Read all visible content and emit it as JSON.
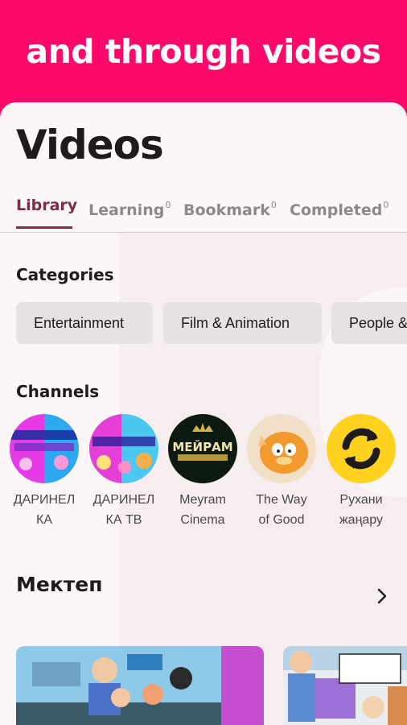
{
  "banner": {
    "text": "and through videos"
  },
  "page": {
    "title": "Videos"
  },
  "tabs": [
    {
      "label": "Library",
      "badge": ""
    },
    {
      "label": "Learning",
      "badge": "0"
    },
    {
      "label": "Bookmark",
      "badge": "0"
    },
    {
      "label": "Completed",
      "badge": "0"
    }
  ],
  "categories": {
    "title": "Categories",
    "items": [
      "Entertainment",
      "Film & Animation",
      "People &"
    ]
  },
  "channels": {
    "title": "Channels",
    "items": [
      {
        "label": "ДАРИНЕЛКА",
        "line1": "ДАРИНЕЛ",
        "line2": "КА",
        "icon": "darinelka-avatar"
      },
      {
        "label": "ДАРИНЕЛКА ТВ",
        "line1": "ДАРИНЕЛ",
        "line2": "КА ТВ",
        "icon": "darinelka-tv-avatar"
      },
      {
        "label": "Meyram Cinema",
        "line1": "Meyram",
        "line2": "Cinema",
        "icon": "meyram-avatar",
        "avatar_text": "МЕЙРАМ"
      },
      {
        "label": "The Way of Good",
        "line1": "The Way",
        "line2": "of Good",
        "icon": "garfield-avatar"
      },
      {
        "label": "Рухани жаңару",
        "line1": "Рухани",
        "line2": "жаңару",
        "icon": "refresh-arrows-avatar"
      }
    ]
  },
  "row": {
    "title": "Мектеп"
  },
  "colors": {
    "brand": "#fb0a6b",
    "accent": "#7a2d4c",
    "sheet": "#fcf6f6",
    "chip": "#e6e1e2"
  }
}
